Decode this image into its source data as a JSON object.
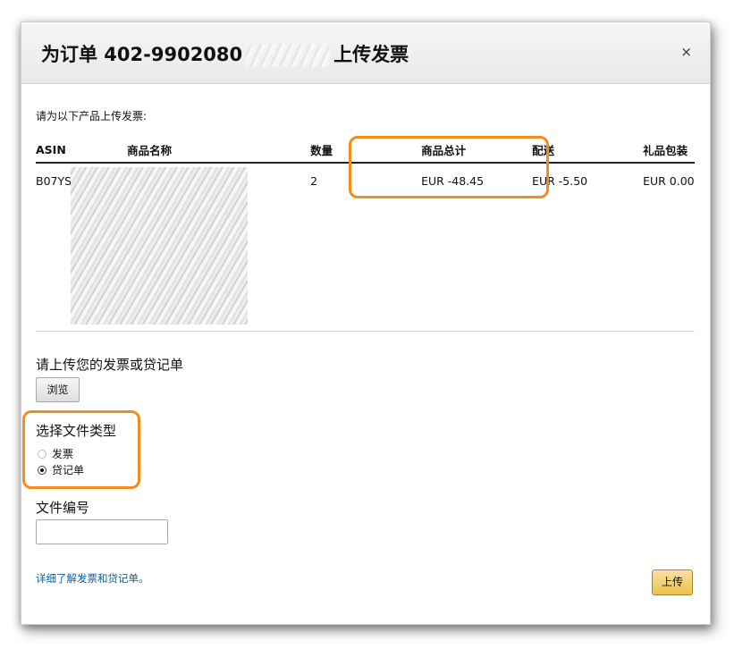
{
  "dialog": {
    "title_prefix": "为订单 402-9902080",
    "title_suffix": "上传发票",
    "close_symbol": "×"
  },
  "intro_text": "请为以下产品上传发票:",
  "table": {
    "headers": [
      "ASIN",
      "商品名称",
      "数量",
      "商品总计",
      "配送",
      "礼品包装"
    ],
    "rows": [
      {
        "asin": "B07YS",
        "name": "",
        "qty": "2",
        "total": "EUR -48.45",
        "shipping": "EUR -5.50",
        "gift": "EUR 0.00"
      }
    ]
  },
  "upload": {
    "label": "请上传您的发票或贷记单",
    "browse_label": "浏览"
  },
  "file_type": {
    "label": "选择文件类型",
    "options": [
      {
        "label": "发票",
        "checked": false
      },
      {
        "label": "贷记单",
        "checked": true
      }
    ]
  },
  "doc_number": {
    "label": "文件编号",
    "value": ""
  },
  "learn_more": "详细了解发票和贷记单。",
  "upload_button": "上传",
  "colors": {
    "highlight": "#f28c1c",
    "link": "#0b5fa5",
    "button": "#f0c14b"
  }
}
